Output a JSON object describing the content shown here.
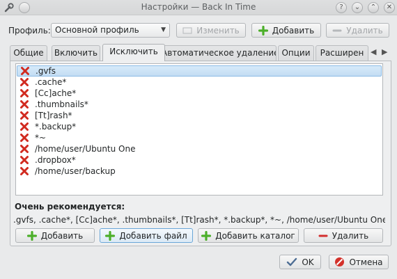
{
  "window": {
    "title": "Настройки — Back In Time"
  },
  "profile": {
    "label": "Профиль:",
    "selected": "Основной профиль",
    "edit_label": "Изменить",
    "add_label": "Добавить",
    "remove_label": "Удалить"
  },
  "tabs": [
    {
      "label": "Общие"
    },
    {
      "label": "Включить"
    },
    {
      "label": "Исключить"
    },
    {
      "label": "Автоматическое удаление"
    },
    {
      "label": "Опции"
    },
    {
      "label": "Расширен"
    }
  ],
  "exclude_list": [
    ".gvfs",
    ".cache*",
    "[Cc]ache*",
    ".thumbnails*",
    "[Tt]rash*",
    "*.backup*",
    "*~",
    "/home/user/Ubuntu One",
    ".dropbox*",
    "/home/user/backup"
  ],
  "recommended": {
    "title": "Очень рекомендуется:",
    "text": ".gvfs, .cache*, [Cc]ache*, .thumbnails*, [Tt]rash*, *.backup*, *~, /home/user/Ubuntu One, .dropbox*"
  },
  "actions": {
    "add": "Добавить",
    "add_file": "Добавить файл",
    "add_folder": "Добавить каталог",
    "remove": "Удалить"
  },
  "dialog": {
    "ok": "OK",
    "cancel": "Отмена"
  },
  "colors": {
    "selection": "#c3ddf3",
    "add_icon": "#4caf2a",
    "remove_icon": "#d32f2f",
    "x_icon": "#d12a1f"
  }
}
